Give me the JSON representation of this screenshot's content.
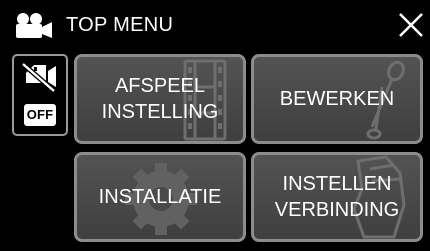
{
  "header": {
    "title": "TOP MENU",
    "mode_icon": "video-camera-icon",
    "close_icon": "close-icon"
  },
  "status": {
    "card_icon": "no-sd-card-icon",
    "off_label": "OFF"
  },
  "tiles": [
    {
      "label": "AFSPEEL\nINSTELLING",
      "icon": "film-strip-icon"
    },
    {
      "label": "BEWERKEN",
      "icon": "scissors-icon"
    },
    {
      "label": "INSTALLATIE",
      "icon": "gear-icon"
    },
    {
      "label": "INSTELLEN\nVERBINDING",
      "icon": "hand-icon"
    }
  ],
  "colors": {
    "background": "#000000",
    "tile": "#4a4a4a",
    "tile_border": "#8c8c8c",
    "text": "#ffffff"
  }
}
